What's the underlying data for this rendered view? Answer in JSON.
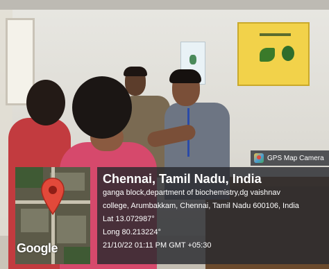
{
  "overlay": {
    "app_label": "GPS Map Camera",
    "app_icon": "gps-map-camera-icon",
    "map_brand": "Google",
    "city": "Chennai, Tamil Nadu, India",
    "address_line1": "ganga block,department of biochemistry,dg vaishnav",
    "address_line2": "college, Arumbakkam, Chennai, Tamil Nadu 600106, India",
    "latitude": "Lat 13.072987°",
    "longitude": "Long 80.213224°",
    "timestamp": "21/10/22 01:11 PM GMT +05:30",
    "pin_color": "#e2493a"
  }
}
